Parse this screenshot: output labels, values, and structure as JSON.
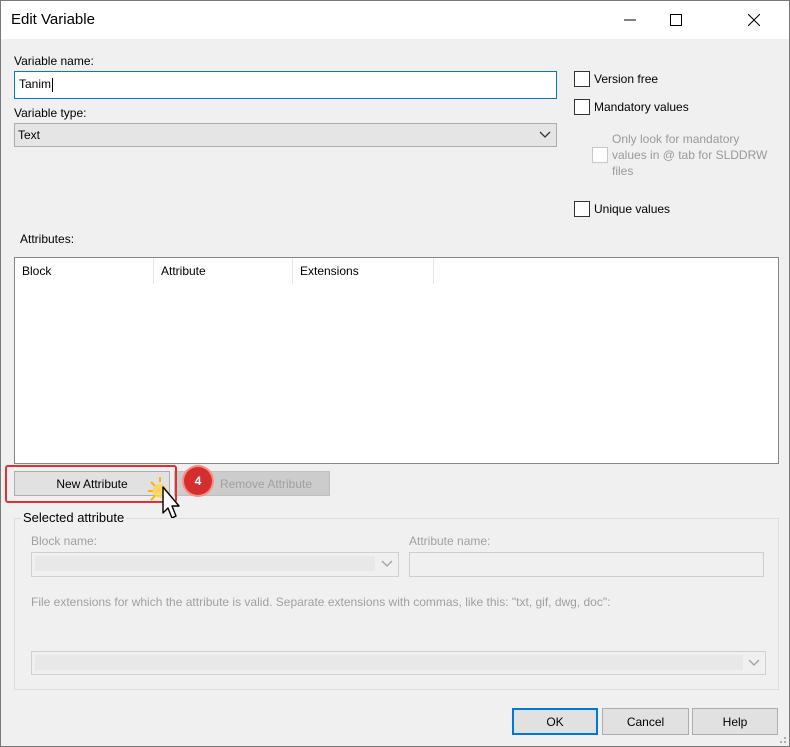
{
  "window": {
    "title": "Edit Variable",
    "controls": {
      "minimize": "minimize-icon",
      "maximize": "maximize-icon",
      "close": "close-icon"
    }
  },
  "form": {
    "variable_name_label": "Variable name:",
    "variable_name_value": "Tanim",
    "variable_type_label": "Variable type:",
    "variable_type_value": "Text"
  },
  "options": {
    "version_free": "Version free",
    "mandatory_values": "Mandatory values",
    "only_look_for_mandatory": [
      "Only look for mandatory",
      "values in @ tab for SLDDRW",
      "files"
    ],
    "unique_values": "Unique values"
  },
  "attributes": {
    "label": "Attributes:",
    "columns": [
      "Block",
      "Attribute",
      "Extensions"
    ],
    "rows": []
  },
  "buttons": {
    "new_attribute": "New Attribute",
    "remove_attribute": "Remove Attribute",
    "ok": "OK",
    "cancel": "Cancel",
    "help": "Help"
  },
  "selected_attribute": {
    "title": "Selected attribute",
    "block_name_label": "Block name:",
    "attribute_name_label": "Attribute name:",
    "extensions_label": "File extensions for which the attribute is valid. Separate extensions with commas, like this: \"txt, gif, dwg, doc\":"
  },
  "annotation": {
    "step_number": "4",
    "highlight_color": "#e03030",
    "cursor": "pointer-hand-icon"
  },
  "colors": {
    "accent": "#0078d7",
    "badge": "#d32f2f"
  }
}
